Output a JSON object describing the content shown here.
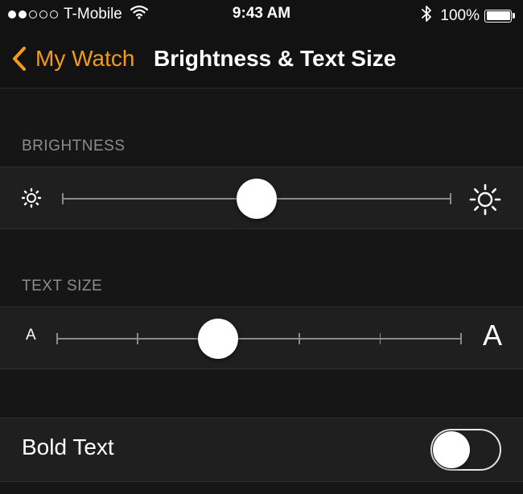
{
  "status_bar": {
    "carrier": "T-Mobile",
    "signal_bars_filled": 2,
    "signal_bars_total": 5,
    "time": "9:43 AM",
    "battery_percent": "100%",
    "icons": [
      "wifi-icon",
      "bluetooth-icon",
      "battery-icon"
    ]
  },
  "nav": {
    "back_label": "My Watch",
    "title": "Brightness & Text Size"
  },
  "brightness": {
    "header": "BRIGHTNESS",
    "value": 0.5,
    "min_icon": "sun-small-icon",
    "max_icon": "sun-large-icon"
  },
  "text_size": {
    "header": "TEXT SIZE",
    "steps": 6,
    "selected_step": 3,
    "min_label": "A",
    "max_label": "A"
  },
  "bold_text": {
    "label": "Bold Text",
    "enabled": false
  },
  "colors": {
    "accent": "#f29a1a",
    "background": "#161616",
    "row_background": "#1f1f1f",
    "section_header": "#8c8c8c"
  }
}
